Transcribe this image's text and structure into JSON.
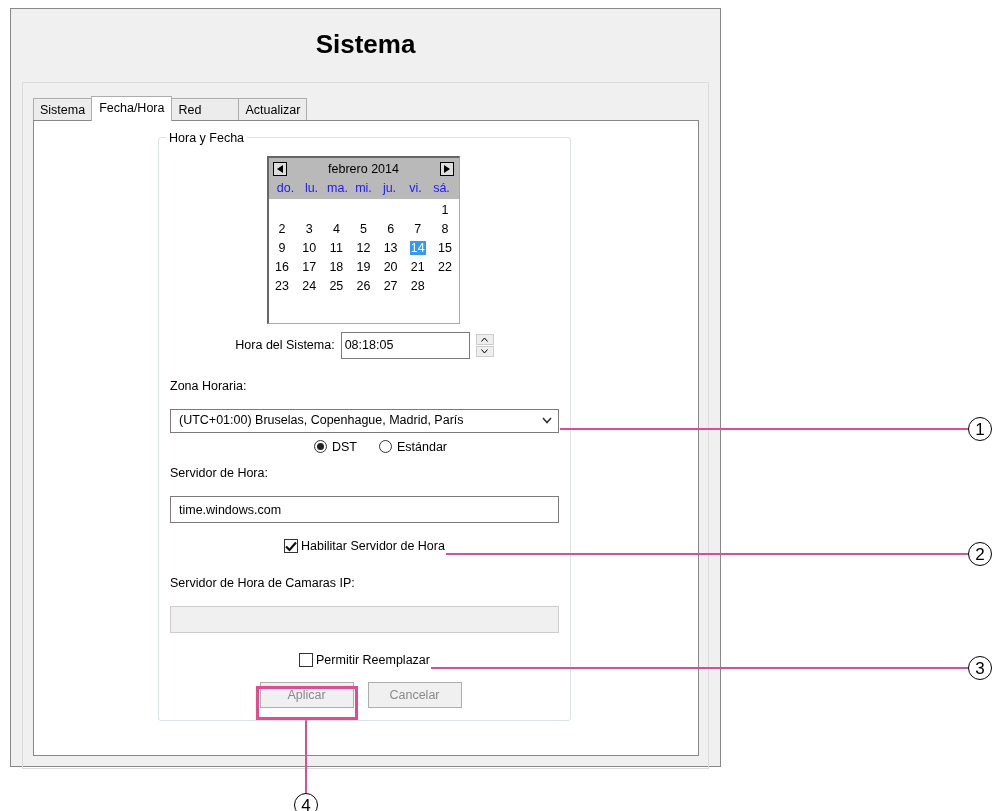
{
  "window": {
    "title": "Sistema"
  },
  "tabs": [
    {
      "label": "Sistema",
      "selected": false
    },
    {
      "label": "Fecha/Hora",
      "selected": true
    },
    {
      "label": "Red",
      "selected": false
    },
    {
      "label": "Actualizar",
      "selected": false
    }
  ],
  "group": {
    "title": "Hora y Fecha"
  },
  "calendar": {
    "month": "febrero 2014",
    "weekdays": [
      "do.",
      "lu.",
      "ma.",
      "mi.",
      "ju.",
      "vi.",
      "sá."
    ],
    "weeks": [
      [
        {
          "day": "1",
          "selected": false
        }
      ],
      [
        {
          "day": "2",
          "selected": false
        },
        {
          "day": "3",
          "selected": false
        },
        {
          "day": "4",
          "selected": false
        },
        {
          "day": "5",
          "selected": false
        },
        {
          "day": "6",
          "selected": false
        },
        {
          "day": "7",
          "selected": false
        },
        {
          "day": "8",
          "selected": false
        }
      ],
      [
        {
          "day": "9",
          "selected": false
        },
        {
          "day": "10",
          "selected": false
        },
        {
          "day": "11",
          "selected": false
        },
        {
          "day": "12",
          "selected": false
        },
        {
          "day": "13",
          "selected": false
        },
        {
          "day": "14",
          "selected": true
        },
        {
          "day": "15",
          "selected": false
        }
      ],
      [
        {
          "day": "16",
          "selected": false
        },
        {
          "day": "17",
          "selected": false
        },
        {
          "day": "18",
          "selected": false
        },
        {
          "day": "19",
          "selected": false
        },
        {
          "day": "20",
          "selected": false
        },
        {
          "day": "21",
          "selected": false
        },
        {
          "day": "22",
          "selected": false
        }
      ],
      [
        {
          "day": "23",
          "selected": false
        },
        {
          "day": "24",
          "selected": false
        },
        {
          "day": "25",
          "selected": false
        },
        {
          "day": "26",
          "selected": false
        },
        {
          "day": "27",
          "selected": false
        },
        {
          "day": "28",
          "selected": false
        }
      ]
    ]
  },
  "system_time": {
    "label": "Hora del Sistema:",
    "value": "08:18:05"
  },
  "timezone": {
    "label": "Zona Horaria:",
    "value": "(UTC+01:00) Bruselas, Copenhague, Madrid, París"
  },
  "dst_options": [
    {
      "label": "DST",
      "selected": true
    },
    {
      "label": "Estándar",
      "selected": false
    }
  ],
  "time_server": {
    "label": "Servidor de Hora:",
    "value": "time.windows.com"
  },
  "enable_time_server": {
    "label": "Habilitar Servidor de Hora",
    "checked": true
  },
  "camera_time_server": {
    "label": "Servidor de Hora de Camaras IP:",
    "disabled": true
  },
  "allow_replace": {
    "label": "Permitir Reemplazar",
    "checked": false
  },
  "buttons": [
    {
      "label": "Aplicar",
      "disabled": true
    },
    {
      "label": "Cancelar",
      "disabled": true
    }
  ],
  "callouts": [
    {
      "number": "1"
    },
    {
      "number": "2"
    },
    {
      "number": "3"
    },
    {
      "number": "4"
    }
  ]
}
